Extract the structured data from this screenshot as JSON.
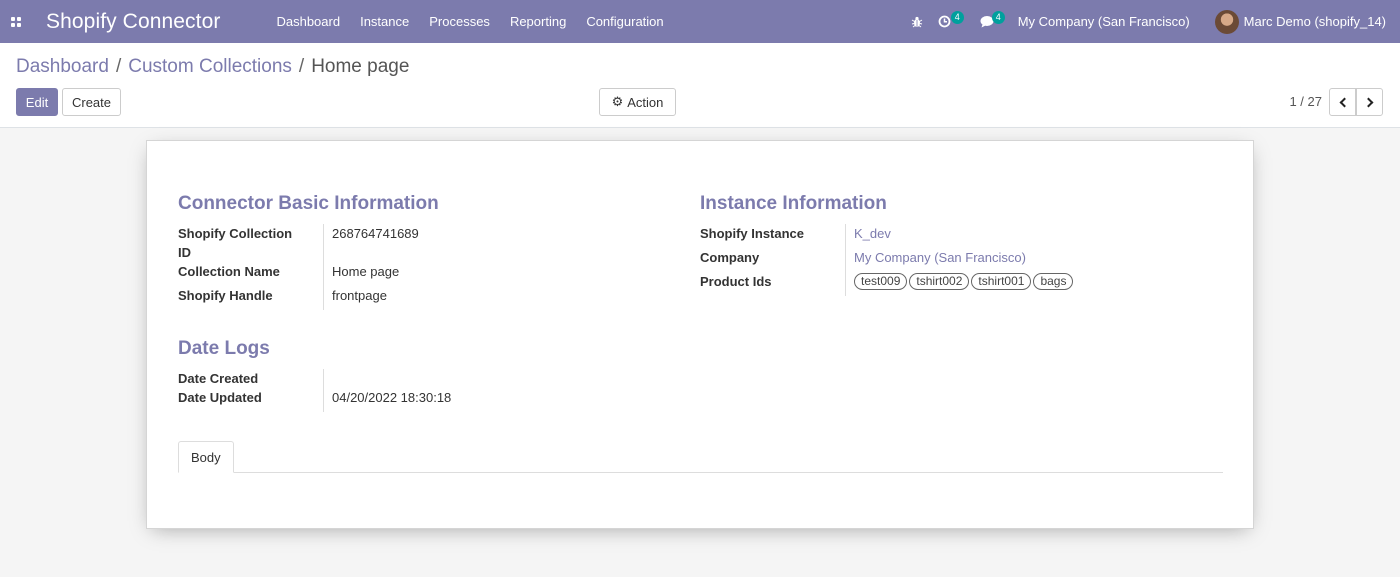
{
  "navbar": {
    "brand": "Shopify Connector",
    "menu": [
      "Dashboard",
      "Instance",
      "Processes",
      "Reporting",
      "Configuration"
    ],
    "activity_count": "4",
    "messages_count": "4",
    "company": "My Company (San Francisco)",
    "user": "Marc Demo (shopify_14)"
  },
  "breadcrumb": {
    "items": [
      "Dashboard",
      "Custom Collections"
    ],
    "current": "Home page"
  },
  "buttons": {
    "edit": "Edit",
    "create": "Create",
    "action": "Action"
  },
  "pager": {
    "value": "1 / 27"
  },
  "form": {
    "basic": {
      "title": "Connector Basic Information",
      "collection_id_label": "Shopify Collection ID",
      "collection_id": "268764741689",
      "collection_name_label": "Collection Name",
      "collection_name": "Home page",
      "handle_label": "Shopify Handle",
      "handle": "frontpage"
    },
    "instance": {
      "title": "Instance Information",
      "instance_label": "Shopify Instance",
      "instance": "K_dev",
      "company_label": "Company",
      "company": "My Company (San Francisco)",
      "products_label": "Product Ids",
      "products": [
        "test009",
        "tshirt002",
        "tshirt001",
        "bags"
      ]
    },
    "dates": {
      "title": "Date Logs",
      "created_label": "Date Created",
      "created": "",
      "updated_label": "Date Updated",
      "updated": "04/20/2022 18:30:18"
    },
    "tabs": [
      "Body"
    ]
  },
  "colors": {
    "brand": "#7c7bad",
    "badge": "#00a09d"
  },
  "icons": [
    "apps-grid-icon",
    "bug-icon",
    "clock-activity-icon",
    "chat-icon",
    "gear-icon",
    "chevron-left-icon",
    "chevron-right-icon"
  ]
}
